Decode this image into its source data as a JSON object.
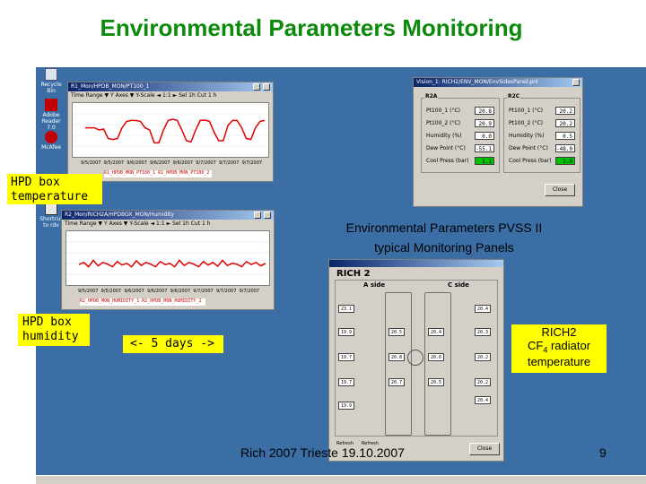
{
  "slide": {
    "title": "Environmental Parameters Monitoring",
    "caption_line1": "Environmental Parameters  PVSS II",
    "caption_line2": "typical Monitoring Panels",
    "footer": "Rich 2007 Trieste 19.10.2007",
    "page_number": "9"
  },
  "callouts": {
    "hpd_temp": [
      "HPD box",
      "temperature"
    ],
    "hpd_humidity": [
      "HPD box",
      "humidity"
    ],
    "days": "<- 5 days ->",
    "rich2_line1": "RICH2",
    "rich2_cf": "CF",
    "rich2_sub": "4",
    "rich2_rest": " radiator",
    "rich2_line3": "temperature"
  },
  "desktop_icons": [
    {
      "label": "Recycle Bin"
    },
    {
      "label": "Adobe Reader 7.0"
    },
    {
      "label": "McAfee"
    },
    {
      "label": "Shortcut to rdv"
    }
  ],
  "trend_top": {
    "title": "R1_Mon/HPDB_MON/PT100_1",
    "toolbar": "Time Range ▼  Y Axes ▼  Y-Scale  ◄ 1:1 ►  Sel 1h  Cut  1 h",
    "x_ticks": [
      "9/5/2007",
      "9/5/2007",
      "9/6/2007",
      "9/6/2007",
      "9/6/2007",
      "9/7/2007",
      "9/7/2007",
      "9/7/2007"
    ],
    "y_ticks": [
      "25.0",
      "22.0",
      "20.0"
    ],
    "legend": "R1_HPDB_MON_PT100_1  R1_HPDB_MON_PT100_2"
  },
  "trend_bottom": {
    "title": "R2_Mon/RICH2A/HPDBOX_MON/Humidity",
    "toolbar": "Time Range ▼  Y Axes ▼  Y-Scale  ◄ 1:1 ►  Sel 1h  Cut  1 h",
    "x_ticks": [
      "9/5/2007",
      "9/5/2007",
      "9/6/2007",
      "9/6/2007",
      "9/6/2007",
      "9/7/2007",
      "9/7/2007",
      "9/7/2007"
    ],
    "y_ticks": [
      "50",
      "40",
      "30"
    ],
    "legend": "R2_HPDB_MON_HUMIDITY_1  R2_HPDB_MON_HUMIDITY_2"
  },
  "pvss_panel": {
    "title": "Vision_1: RICH2/ENV_MON/EnvSidesPanel.pnl",
    "r2a": {
      "heading": "R2A",
      "rows": [
        {
          "label": "Pt100_1 (°C)",
          "value": "20.8"
        },
        {
          "label": "Pt100_2 (°C)",
          "value": "20.9"
        },
        {
          "label": "Humidity (%)",
          "value": "0.0"
        },
        {
          "label": "Dew Point (°C)",
          "value": "-55.1"
        },
        {
          "label": "Cool Press (bar)",
          "value": "1.1"
        }
      ]
    },
    "r2c": {
      "heading": "R2C",
      "rows": [
        {
          "label": "Pt100_1 (°C)",
          "value": "20.2"
        },
        {
          "label": "Pt100_2 (°C)",
          "value": "20.2"
        },
        {
          "label": "Humidity (%)",
          "value": "0.5"
        },
        {
          "label": "Dew Point (°C)",
          "value": "-48.0"
        },
        {
          "label": "Cool Press (bar)",
          "value": "1.0"
        }
      ]
    },
    "close": "Close"
  },
  "rich_panel": {
    "heading": "RICH 2",
    "a_side": "A side",
    "c_side": "C side",
    "values_left": [
      "23.1",
      "19.9",
      "19.7",
      "19.7",
      "19.9"
    ],
    "values_center_a": [
      "20.5",
      "20.8",
      "20.7"
    ],
    "values_center_c": [
      "20.4",
      "20.6",
      "20.5"
    ],
    "values_right": [
      "20.4",
      "20.3",
      "20.2",
      "20.2",
      "20.4"
    ],
    "bottom_labels": [
      "Refresh",
      "Refresh"
    ],
    "close": "Close"
  },
  "colors": {
    "title_green": "#0b8a0b",
    "callout_yellow": "#ffff00",
    "desktop_blue": "#3a6ea5",
    "plot_red": "#e00000",
    "value_green": "#00c000"
  },
  "series": {
    "temperature": [
      0.55,
      0.55,
      0.55,
      0.5,
      0.52,
      0.3,
      0.28,
      0.3,
      0.55,
      0.7,
      0.72,
      0.72,
      0.7,
      0.55,
      0.5,
      0.2,
      0.2,
      0.5,
      0.72,
      0.75,
      0.72,
      0.5,
      0.25,
      0.22,
      0.5,
      0.72,
      0.73,
      0.7,
      0.45,
      0.25,
      0.25,
      0.6,
      0.72,
      0.72,
      0.55,
      0.3,
      0.28,
      0.55,
      0.7,
      0.72
    ],
    "humidity": [
      0.35,
      0.4,
      0.3,
      0.45,
      0.32,
      0.4,
      0.36,
      0.3,
      0.42,
      0.34,
      0.38,
      0.3,
      0.44,
      0.33,
      0.4,
      0.36,
      0.3,
      0.42,
      0.35,
      0.38,
      0.3,
      0.45,
      0.33,
      0.4,
      0.36,
      0.3,
      0.42,
      0.34,
      0.4,
      0.31,
      0.45,
      0.33,
      0.38,
      0.36,
      0.3,
      0.42,
      0.35,
      0.4,
      0.32,
      0.38
    ]
  }
}
